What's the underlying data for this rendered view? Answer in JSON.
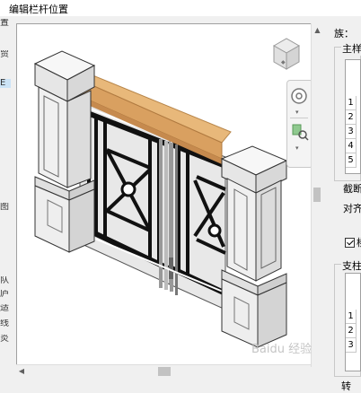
{
  "window": {
    "title": "编辑栏杆位置"
  },
  "left_strip": {
    "chars": [
      "置",
      "贸",
      "E",
      "图",
      "队",
      "庐",
      "适",
      "线",
      "炎"
    ]
  },
  "viewport": {
    "model": "railing-3d-preview"
  },
  "view_cube": {
    "label": ""
  },
  "nav_bar": {
    "icons": [
      "steering-wheel-icon",
      "zoom-region-icon"
    ]
  },
  "right_panel": {
    "family_label": "族：",
    "main_group_label": "主样",
    "main_rows": [
      "1",
      "2",
      "3",
      "4",
      "5"
    ],
    "section_label": "截断",
    "align_label": "对齐",
    "checkbox_label": "楼",
    "post_group_label": "支柱",
    "post_rows": [
      "1",
      "2",
      "3"
    ],
    "bottom_label": "转"
  },
  "watermark": {
    "text": "Baidu 经验"
  },
  "colors": {
    "handrail": "#e8b87a",
    "post": "#f2f2f2",
    "ironwork": "#1a1a1a",
    "border": "#a0a0a0"
  }
}
